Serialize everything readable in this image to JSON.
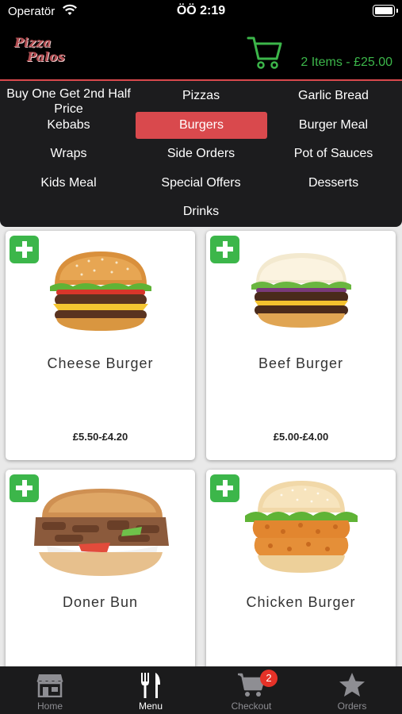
{
  "status_bar": {
    "carrier": "Operatör",
    "time": "ÖÖ 2:19"
  },
  "header": {
    "logo_line1": "Pizza",
    "logo_line2": "Palos",
    "cart_summary": "2 Items - £25.00",
    "cart_icon": "shopping-cart-icon"
  },
  "colors": {
    "accent_red": "#d9494d",
    "accent_green": "#3cb64a",
    "badge_red": "#e53228",
    "menu_bg": "#1c1c1e"
  },
  "categories": [
    {
      "label": "Buy One Get 2nd Half Price"
    },
    {
      "label": "Pizzas"
    },
    {
      "label": "Garlic Bread"
    },
    {
      "label": "Kebabs"
    },
    {
      "label": "Burgers",
      "active": true
    },
    {
      "label": "Burger Meal"
    },
    {
      "label": "Wraps"
    },
    {
      "label": "Side Orders"
    },
    {
      "label": "Pot of Sauces"
    },
    {
      "label": "Kids Meal"
    },
    {
      "label": "Special Offers"
    },
    {
      "label": "Desserts"
    },
    {
      "label": "Drinks"
    }
  ],
  "products": [
    {
      "name": "Cheese Burger",
      "price": "£5.50-£4.20"
    },
    {
      "name": "Beef Burger",
      "price": "£5.00-£4.00"
    },
    {
      "name": "Doner Bun",
      "price": ""
    },
    {
      "name": "Chicken Burger",
      "price": ""
    }
  ],
  "tabs": [
    {
      "label": "Home",
      "icon": "store-icon"
    },
    {
      "label": "Menu",
      "icon": "fork-knife-icon",
      "active": true
    },
    {
      "label": "Checkout",
      "icon": "cart-icon",
      "badge": "2"
    },
    {
      "label": "Orders",
      "icon": "star-icon"
    }
  ]
}
